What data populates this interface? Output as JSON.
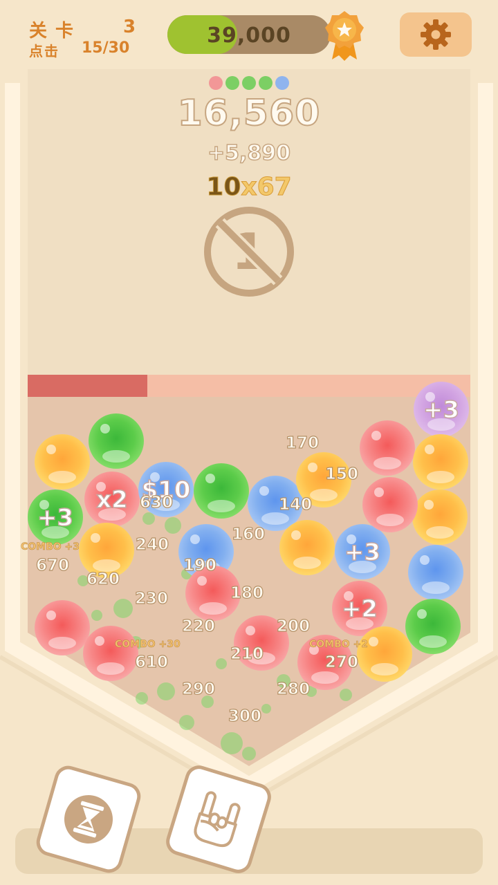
{
  "header": {
    "level_label": "关卡",
    "level_value": "3",
    "clicks_label": "点击",
    "clicks_value": "15/30",
    "progress_text": "39,000",
    "progress_fraction": 0.43,
    "badge_icon": "star-rosette-icon",
    "settings_icon": "gear-icon"
  },
  "board": {
    "color_dots": [
      "#f29797",
      "#7ccf64",
      "#7ccf64",
      "#7ccf64",
      "#8fb4ee"
    ],
    "score": "16,560",
    "gain": "+5,890",
    "mult_base": "10",
    "mult_x": "x",
    "mult_value": "67",
    "no_one_number": "1",
    "time_remaining_fraction": 0.27
  },
  "balls": [
    {
      "color": "orange",
      "label": ""
    },
    {
      "color": "green",
      "label": ""
    },
    {
      "color": "purple",
      "label": "+3"
    },
    {
      "color": "red",
      "label": "x2"
    },
    {
      "color": "blue",
      "label": "$10"
    },
    {
      "color": "green",
      "label": ""
    },
    {
      "color": "blue",
      "label": ""
    },
    {
      "color": "orange",
      "label": ""
    },
    {
      "color": "red",
      "label": ""
    },
    {
      "color": "orange",
      "label": ""
    },
    {
      "color": "green",
      "label": "+3"
    },
    {
      "color": "orange",
      "label": ""
    },
    {
      "color": "blue",
      "label": ""
    },
    {
      "color": "orange",
      "label": ""
    },
    {
      "color": "orange",
      "label": ""
    },
    {
      "color": "blue",
      "label": "+3"
    },
    {
      "color": "red",
      "label": ""
    },
    {
      "color": "blue",
      "label": ""
    },
    {
      "color": "red",
      "label": ""
    },
    {
      "color": "red",
      "label": ""
    },
    {
      "color": "red",
      "label": ""
    },
    {
      "color": "red",
      "label": "+2"
    },
    {
      "color": "green",
      "label": ""
    },
    {
      "color": "red",
      "label": ""
    },
    {
      "color": "orange",
      "label": ""
    },
    {
      "color": "red",
      "label": ""
    }
  ],
  "floating_numbers": [
    "170",
    "150",
    "630",
    "140",
    "160",
    "240",
    "190",
    "620",
    "670",
    "180",
    "230",
    "220",
    "200",
    "210",
    "610",
    "270",
    "290",
    "280",
    "300"
  ],
  "combos": [
    "COMBO +3",
    "COMBO +30",
    "COMBO +2"
  ],
  "tools": {
    "hourglass_icon": "hourglass-icon",
    "rock_hand_icon": "rock-hand-icon"
  }
}
